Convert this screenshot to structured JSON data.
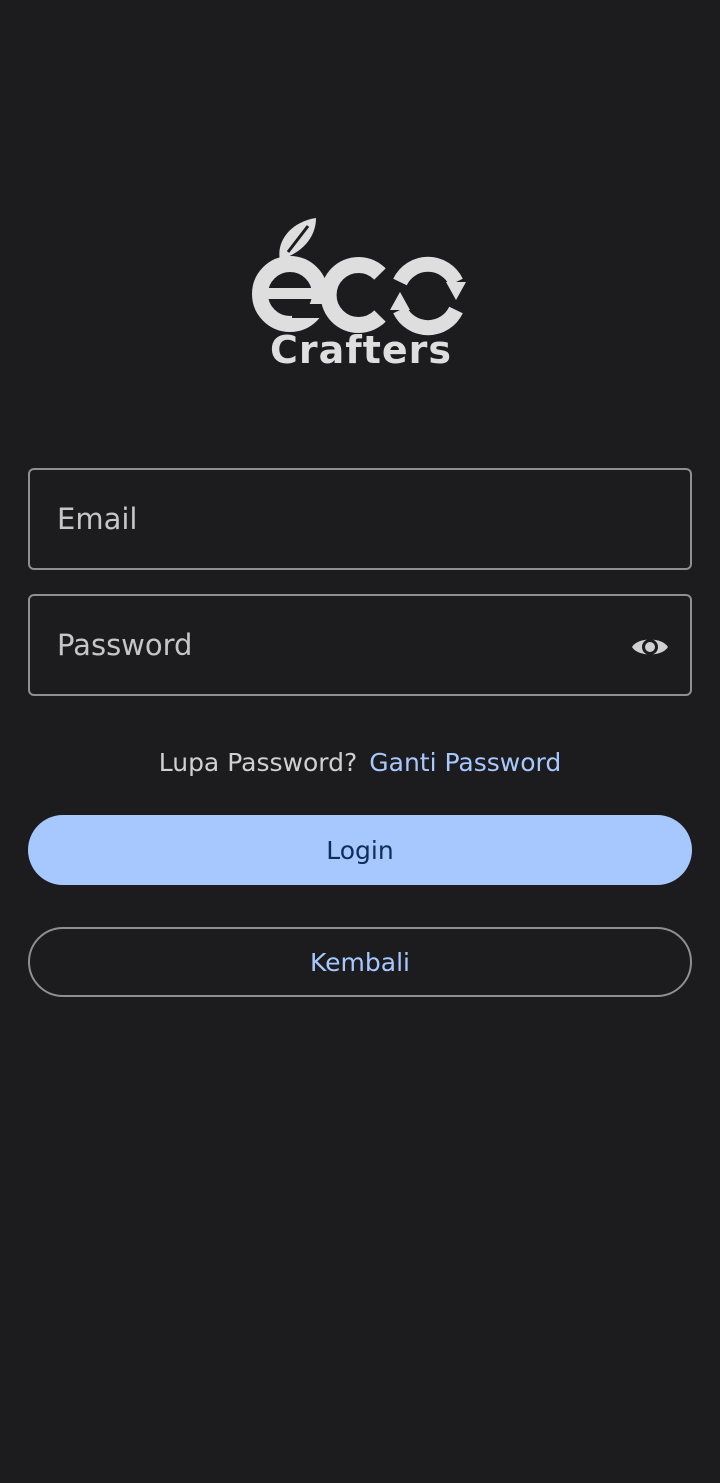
{
  "logo": {
    "wordmark": "eco",
    "caption": "Crafters",
    "color": "#dedede"
  },
  "form": {
    "email": {
      "placeholder": "Email",
      "value": ""
    },
    "password": {
      "placeholder": "Password",
      "value": "",
      "toggle_icon": "eye-icon"
    }
  },
  "forgot": {
    "text": "Lupa Password?",
    "link_label": "Ganti Password"
  },
  "buttons": {
    "login_label": "Login",
    "back_label": "Kembali"
  },
  "colors": {
    "background": "#1c1c1e",
    "accent": "#a7c8ff",
    "on_accent": "#0f2d57",
    "outline": "#8e8e93"
  }
}
